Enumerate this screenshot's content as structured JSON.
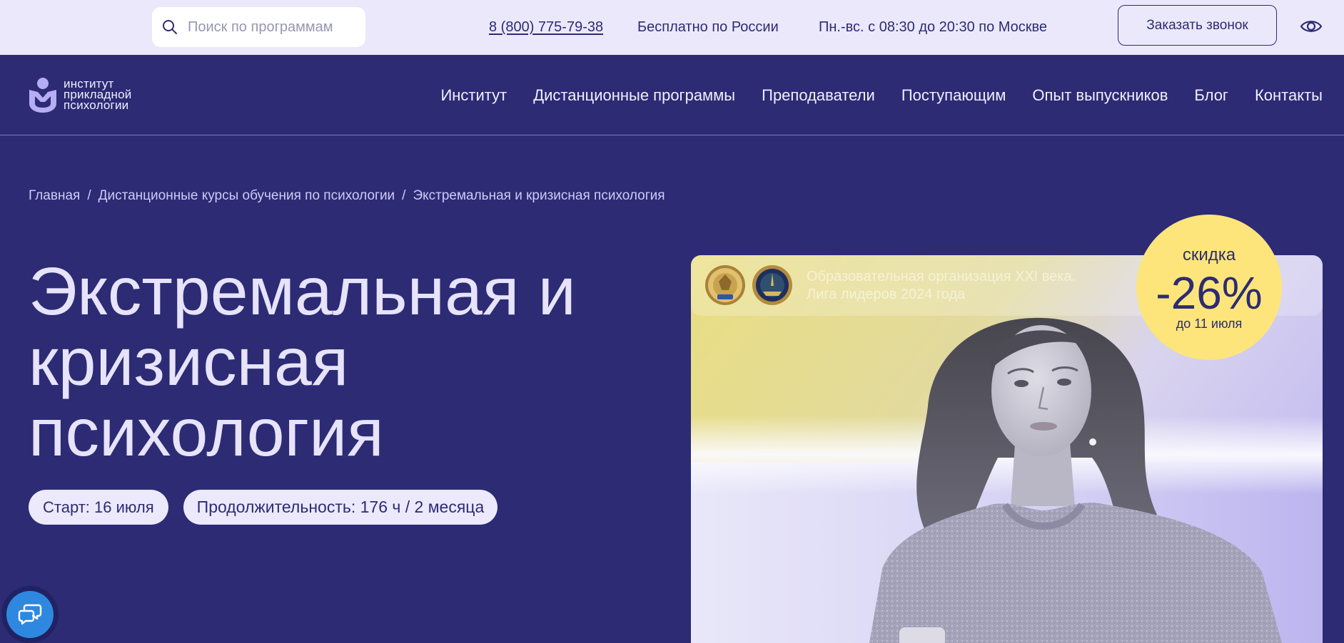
{
  "theme": {
    "navy": "#2c2b74",
    "topbar_bg": "#ebe8fc",
    "title_color": "#e6e3fb",
    "pill_bg": "#ece9fd",
    "accent_yellow": "#fde57b",
    "chat_blue": "#2f88df"
  },
  "icons": {
    "search": "search-icon",
    "accessibility": "eye-icon",
    "logo": "logo-icon",
    "award": "medal-icon",
    "chat": "chat-icon"
  },
  "topbar": {
    "search_placeholder": "Поиск по программам",
    "phone": "8 (800) 775-79-38",
    "free_call_note": "Бесплатно по России",
    "working_hours": "Пн.-вс. с 08:30 до 20:30 по Москве",
    "callback_button": "Заказать звонок"
  },
  "header": {
    "logo_lines": [
      "институт",
      "прикладной",
      "психологии"
    ],
    "nav": [
      "Институт",
      "Дистанционные программы",
      "Преподаватели",
      "Поступающим",
      "Опыт выпускников",
      "Блог",
      "Контакты"
    ]
  },
  "breadcrumb": {
    "items": [
      "Главная",
      "Дистанционные курсы обучения по психологии",
      "Экстремальная и кризисная психология"
    ],
    "separator": "/"
  },
  "hero": {
    "title_lines": [
      "Экстремальная и",
      "кризисная",
      "психология"
    ],
    "start": "Старт: 16 июля",
    "duration": "Продолжительность: 176 ч / 2 месяца"
  },
  "promo": {
    "award_lines": [
      "Образовательная организация XXI века.",
      "Лига лидеров 2024 года"
    ],
    "discount_label": "скидка",
    "discount_value": "-26%",
    "discount_deadline": "до 11 июля"
  }
}
